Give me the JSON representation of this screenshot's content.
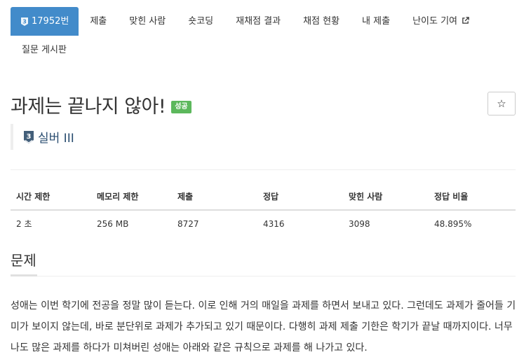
{
  "nav": {
    "active_tab": "17952번",
    "tier_badge_number": "3",
    "tabs": [
      "제출",
      "맞힌 사람",
      "숏코딩",
      "재채점 결과",
      "채점 현황",
      "내 제출",
      "난이도 기여"
    ],
    "second_row_tab": "질문 게시판"
  },
  "problem": {
    "title": "과제는 끝나지 않아!",
    "result_label": "성공",
    "star_glyph": "☆",
    "tier_number": "3",
    "tier": "실버 III"
  },
  "stats": {
    "headers": [
      "시간 제한",
      "메모리 제한",
      "제출",
      "정답",
      "맞힌 사람",
      "정답 비율"
    ],
    "values": [
      "2 초",
      "256 MB",
      "8727",
      "4316",
      "3098",
      "48.895%"
    ]
  },
  "section": {
    "title": "문제",
    "description": "성애는 이번 학기에 전공을 정말 많이 듣는다. 이로 인해 거의 매일을 과제를 하면서 보내고 있다. 그런데도 과제가 줄어들 기미가 보이지 않는데, 바로 분단위로 과제가 추가되고 있기 때문이다. 다행히 과제 제출 기한은 학기가 끝날 때까지이다. 너무나도 많은 과제를 하다가 미쳐버린 성애는 아래와 같은 규칙으로 과제를 해 나가고 있다."
  },
  "colors": {
    "active_tab_bg": "#428bca",
    "success_label": "#5cb85c",
    "tier_silver_dark": "#435f7a",
    "tier_text": "#2a4d70"
  },
  "icons": [
    "silver-tier-badge-icon",
    "external-link-icon",
    "star-icon"
  ]
}
